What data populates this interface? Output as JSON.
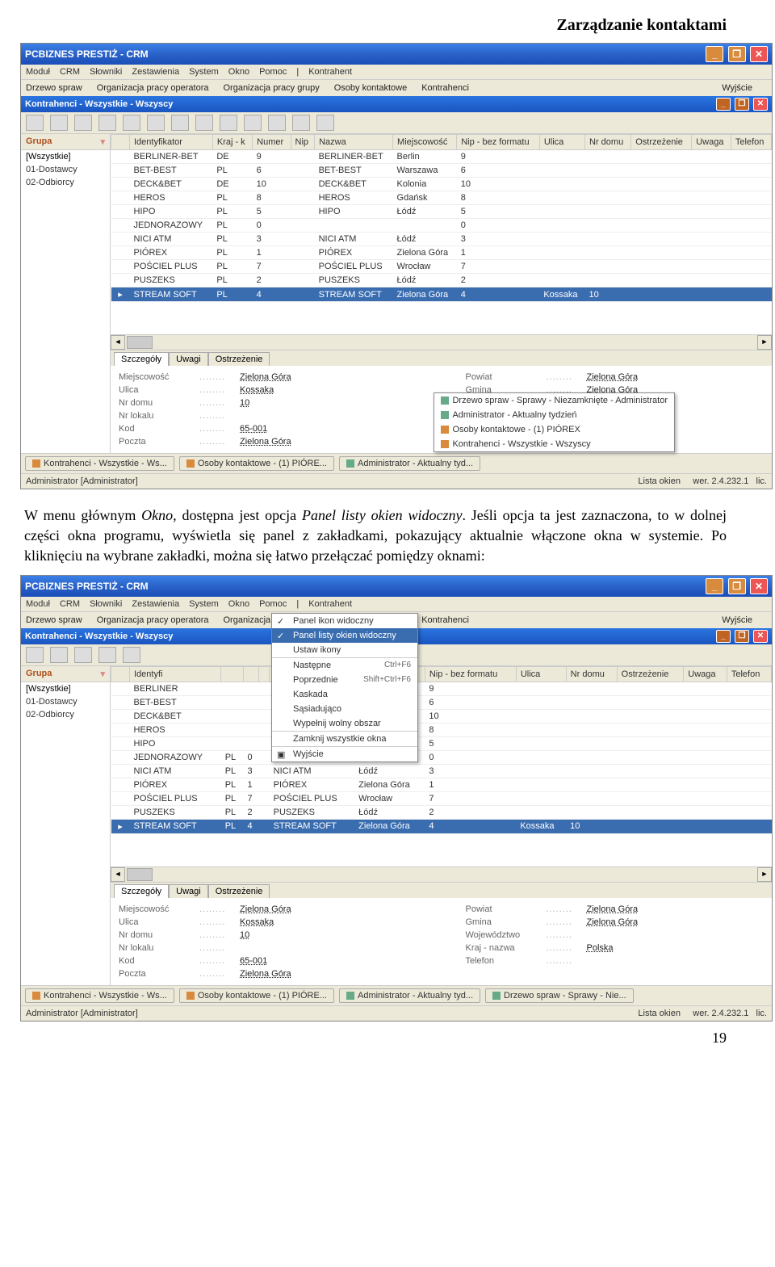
{
  "page_header": "Zarządzanie kontaktami",
  "body_text_1a": "W menu głównym ",
  "body_text_1b": "Okno",
  "body_text_1c": ", dostępna jest opcja ",
  "body_text_1d": "Panel listy okien widoczny",
  "body_text_1e": ". Jeśli opcja ta jest zaznaczona, to w dolnej części okna programu, wyświetla się panel z zakładkami, pokazujący aktualnie włączone okna w systemie. Po kliknięciu na wybrane zakładki, można się łatwo przełączać pomiędzy oknami:",
  "page_num": "19",
  "app_title": "PCBIZNES PRESTIŻ - CRM",
  "menubar": [
    "Moduł",
    "CRM",
    "Słowniki",
    "Zestawienia",
    "System",
    "Okno",
    "Pomoc",
    "|",
    "Kontrahent"
  ],
  "toolbar2": [
    "Drzewo spraw",
    "Organizacja pracy operatora",
    "Organizacja pracy grupy",
    "Osoby kontaktowe",
    "Kontrahenci"
  ],
  "toolbar2_right": "Wyjście",
  "child_title": "Kontrahenci - Wszystkie - Wszyscy",
  "grp_head": "Grupa",
  "groups": [
    "[Wszystkie]",
    "01-Dostawcy",
    "02-Odbiorcy"
  ],
  "columns": [
    "Identyfikator",
    "Kraj - k",
    "Numer",
    "Nip",
    "Nazwa",
    "Miejscowość",
    "Nip - bez formatu",
    "Ulica",
    "Nr domu",
    "Ostrzeżenie",
    "Uwaga",
    "Telefon"
  ],
  "rows": [
    {
      "id": "BERLINER-BET",
      "kraj": "DE",
      "num": "9",
      "nip": "",
      "nazwa": "BERLINER-BET",
      "miej": "Berlin",
      "nipb": "9",
      "ul": "",
      "dom": "",
      "ost": "",
      "uw": "",
      "tel": ""
    },
    {
      "id": "BET-BEST",
      "kraj": "PL",
      "num": "6",
      "nip": "",
      "nazwa": "BET-BEST",
      "miej": "Warszawa",
      "nipb": "6",
      "ul": "",
      "dom": "",
      "ost": "",
      "uw": "",
      "tel": ""
    },
    {
      "id": "DECK&BET",
      "kraj": "DE",
      "num": "10",
      "nip": "",
      "nazwa": "DECK&BET",
      "miej": "Kolonia",
      "nipb": "10",
      "ul": "",
      "dom": "",
      "ost": "",
      "uw": "",
      "tel": ""
    },
    {
      "id": "HEROS",
      "kraj": "PL",
      "num": "8",
      "nip": "",
      "nazwa": "HEROS",
      "miej": "Gdańsk",
      "nipb": "8",
      "ul": "",
      "dom": "",
      "ost": "",
      "uw": "",
      "tel": ""
    },
    {
      "id": "HIPO",
      "kraj": "PL",
      "num": "5",
      "nip": "",
      "nazwa": "HIPO",
      "miej": "Łódź",
      "nipb": "5",
      "ul": "",
      "dom": "",
      "ost": "",
      "uw": "",
      "tel": ""
    },
    {
      "id": "JEDNORAZOWY",
      "kraj": "PL",
      "num": "0",
      "nip": "",
      "nazwa": "",
      "miej": "",
      "nipb": "0",
      "ul": "",
      "dom": "",
      "ost": "",
      "uw": "",
      "tel": ""
    },
    {
      "id": "NICI ATM",
      "kraj": "PL",
      "num": "3",
      "nip": "",
      "nazwa": "NICI ATM",
      "miej": "Łódź",
      "nipb": "3",
      "ul": "",
      "dom": "",
      "ost": "",
      "uw": "",
      "tel": ""
    },
    {
      "id": "PIÓREX",
      "kraj": "PL",
      "num": "1",
      "nip": "",
      "nazwa": "PIÓREX",
      "miej": "Zielona Góra",
      "nipb": "1",
      "ul": "",
      "dom": "",
      "ost": "",
      "uw": "",
      "tel": ""
    },
    {
      "id": "POŚCIEL PLUS",
      "kraj": "PL",
      "num": "7",
      "nip": "",
      "nazwa": "POŚCIEL PLUS",
      "miej": "Wrocław",
      "nipb": "7",
      "ul": "",
      "dom": "",
      "ost": "",
      "uw": "",
      "tel": ""
    },
    {
      "id": "PUSZEKS",
      "kraj": "PL",
      "num": "2",
      "nip": "",
      "nazwa": "PUSZEKS",
      "miej": "Łódź",
      "nipb": "2",
      "ul": "",
      "dom": "",
      "ost": "",
      "uw": "",
      "tel": ""
    },
    {
      "id": "STREAM SOFT",
      "kraj": "PL",
      "num": "4",
      "nip": "",
      "nazwa": "STREAM SOFT",
      "miej": "Zielona Góra",
      "nipb": "4",
      "ul": "Kossaka",
      "dom": "10",
      "ost": "",
      "uw": "",
      "tel": ""
    }
  ],
  "detail_tabs": [
    "Szczegóły",
    "Uwagi",
    "Ostrzeżenie"
  ],
  "details_left": [
    {
      "lab": "Miejscowość",
      "val": "Zielona Góra"
    },
    {
      "lab": "Ulica",
      "val": "Kossaka"
    },
    {
      "lab": "Nr domu",
      "val": "10"
    },
    {
      "lab": "Nr lokalu",
      "val": ""
    },
    {
      "lab": "Kod",
      "val": "65-001"
    },
    {
      "lab": "Poczta",
      "val": "Zielona Góra"
    }
  ],
  "details_right": [
    {
      "lab": "Powiat",
      "val": "Zielona Góra"
    },
    {
      "lab": "Gmina",
      "val": "Zielona Góra"
    },
    {
      "lab": "Województwo",
      "val": ""
    },
    {
      "lab": "Kraj - nazwa",
      "val": "Polska"
    },
    {
      "lab": "Telefon",
      "val": ""
    }
  ],
  "taskbar_btns_1": [
    "Kontrahenci - Wszystkie - Ws...",
    "Osoby kontaktowe - (1) PIÓRE...",
    "Administrator - Aktualny tyd..."
  ],
  "taskbar_btns_2": [
    "Kontrahenci - Wszystkie - Ws...",
    "Osoby kontaktowe - (1) PIÓRE...",
    "Administrator - Aktualny tyd...",
    "Drzewo spraw - Sprawy - Nie..."
  ],
  "popup_items": [
    "Drzewo spraw - Sprawy - Niezamknięte - Administrator",
    "Administrator - Aktualny tydzień",
    "Osoby kontaktowe - (1) PIÓREX",
    "Kontrahenci - Wszystkie - Wszyscy"
  ],
  "status_left": "Administrator [Administrator]",
  "status_mid": "Lista okien",
  "status_right": "wer. 2.4.232.1",
  "status_lic": "lic.",
  "okno_menu": [
    {
      "lab": "Panel ikon widoczny",
      "chk": true,
      "hl": false
    },
    {
      "lab": "Panel listy okien widoczny",
      "chk": true,
      "hl": true
    },
    {
      "lab": "Ustaw ikony",
      "chk": false,
      "hl": false,
      "sep": true
    },
    {
      "lab": "Następne",
      "sc": "Ctrl+F6"
    },
    {
      "lab": "Poprzednie",
      "sc": "Shift+Ctrl+F6"
    },
    {
      "lab": "Kaskada"
    },
    {
      "lab": "Sąsiadująco"
    },
    {
      "lab": "Wypełnij wolny obszar",
      "sep": true
    },
    {
      "lab": "Zamknij wszystkie okna",
      "sep": true
    },
    {
      "lab": "Wyjście",
      "ico": "door"
    }
  ]
}
